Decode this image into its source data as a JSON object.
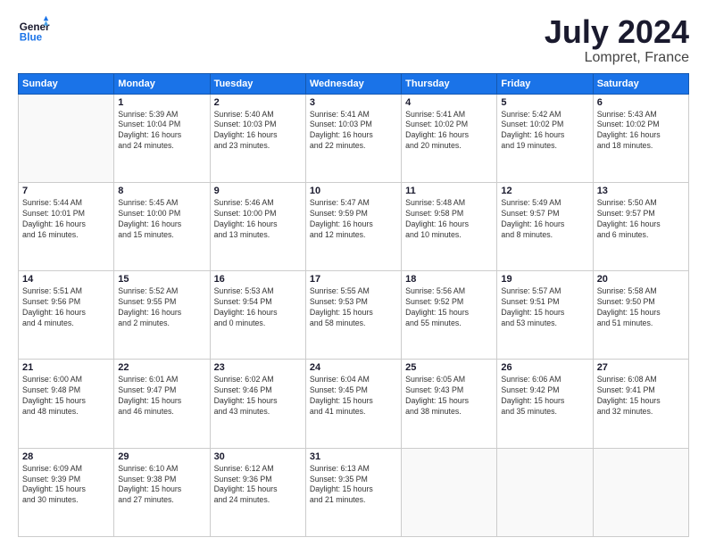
{
  "header": {
    "logo_line1": "General",
    "logo_line2": "Blue",
    "month": "July 2024",
    "location": "Lompret, France"
  },
  "weekdays": [
    "Sunday",
    "Monday",
    "Tuesday",
    "Wednesday",
    "Thursday",
    "Friday",
    "Saturday"
  ],
  "weeks": [
    [
      {
        "day": "",
        "info": ""
      },
      {
        "day": "1",
        "info": "Sunrise: 5:39 AM\nSunset: 10:04 PM\nDaylight: 16 hours\nand 24 minutes."
      },
      {
        "day": "2",
        "info": "Sunrise: 5:40 AM\nSunset: 10:03 PM\nDaylight: 16 hours\nand 23 minutes."
      },
      {
        "day": "3",
        "info": "Sunrise: 5:41 AM\nSunset: 10:03 PM\nDaylight: 16 hours\nand 22 minutes."
      },
      {
        "day": "4",
        "info": "Sunrise: 5:41 AM\nSunset: 10:02 PM\nDaylight: 16 hours\nand 20 minutes."
      },
      {
        "day": "5",
        "info": "Sunrise: 5:42 AM\nSunset: 10:02 PM\nDaylight: 16 hours\nand 19 minutes."
      },
      {
        "day": "6",
        "info": "Sunrise: 5:43 AM\nSunset: 10:02 PM\nDaylight: 16 hours\nand 18 minutes."
      }
    ],
    [
      {
        "day": "7",
        "info": "Sunrise: 5:44 AM\nSunset: 10:01 PM\nDaylight: 16 hours\nand 16 minutes."
      },
      {
        "day": "8",
        "info": "Sunrise: 5:45 AM\nSunset: 10:00 PM\nDaylight: 16 hours\nand 15 minutes."
      },
      {
        "day": "9",
        "info": "Sunrise: 5:46 AM\nSunset: 10:00 PM\nDaylight: 16 hours\nand 13 minutes."
      },
      {
        "day": "10",
        "info": "Sunrise: 5:47 AM\nSunset: 9:59 PM\nDaylight: 16 hours\nand 12 minutes."
      },
      {
        "day": "11",
        "info": "Sunrise: 5:48 AM\nSunset: 9:58 PM\nDaylight: 16 hours\nand 10 minutes."
      },
      {
        "day": "12",
        "info": "Sunrise: 5:49 AM\nSunset: 9:57 PM\nDaylight: 16 hours\nand 8 minutes."
      },
      {
        "day": "13",
        "info": "Sunrise: 5:50 AM\nSunset: 9:57 PM\nDaylight: 16 hours\nand 6 minutes."
      }
    ],
    [
      {
        "day": "14",
        "info": "Sunrise: 5:51 AM\nSunset: 9:56 PM\nDaylight: 16 hours\nand 4 minutes."
      },
      {
        "day": "15",
        "info": "Sunrise: 5:52 AM\nSunset: 9:55 PM\nDaylight: 16 hours\nand 2 minutes."
      },
      {
        "day": "16",
        "info": "Sunrise: 5:53 AM\nSunset: 9:54 PM\nDaylight: 16 hours\nand 0 minutes."
      },
      {
        "day": "17",
        "info": "Sunrise: 5:55 AM\nSunset: 9:53 PM\nDaylight: 15 hours\nand 58 minutes."
      },
      {
        "day": "18",
        "info": "Sunrise: 5:56 AM\nSunset: 9:52 PM\nDaylight: 15 hours\nand 55 minutes."
      },
      {
        "day": "19",
        "info": "Sunrise: 5:57 AM\nSunset: 9:51 PM\nDaylight: 15 hours\nand 53 minutes."
      },
      {
        "day": "20",
        "info": "Sunrise: 5:58 AM\nSunset: 9:50 PM\nDaylight: 15 hours\nand 51 minutes."
      }
    ],
    [
      {
        "day": "21",
        "info": "Sunrise: 6:00 AM\nSunset: 9:48 PM\nDaylight: 15 hours\nand 48 minutes."
      },
      {
        "day": "22",
        "info": "Sunrise: 6:01 AM\nSunset: 9:47 PM\nDaylight: 15 hours\nand 46 minutes."
      },
      {
        "day": "23",
        "info": "Sunrise: 6:02 AM\nSunset: 9:46 PM\nDaylight: 15 hours\nand 43 minutes."
      },
      {
        "day": "24",
        "info": "Sunrise: 6:04 AM\nSunset: 9:45 PM\nDaylight: 15 hours\nand 41 minutes."
      },
      {
        "day": "25",
        "info": "Sunrise: 6:05 AM\nSunset: 9:43 PM\nDaylight: 15 hours\nand 38 minutes."
      },
      {
        "day": "26",
        "info": "Sunrise: 6:06 AM\nSunset: 9:42 PM\nDaylight: 15 hours\nand 35 minutes."
      },
      {
        "day": "27",
        "info": "Sunrise: 6:08 AM\nSunset: 9:41 PM\nDaylight: 15 hours\nand 32 minutes."
      }
    ],
    [
      {
        "day": "28",
        "info": "Sunrise: 6:09 AM\nSunset: 9:39 PM\nDaylight: 15 hours\nand 30 minutes."
      },
      {
        "day": "29",
        "info": "Sunrise: 6:10 AM\nSunset: 9:38 PM\nDaylight: 15 hours\nand 27 minutes."
      },
      {
        "day": "30",
        "info": "Sunrise: 6:12 AM\nSunset: 9:36 PM\nDaylight: 15 hours\nand 24 minutes."
      },
      {
        "day": "31",
        "info": "Sunrise: 6:13 AM\nSunset: 9:35 PM\nDaylight: 15 hours\nand 21 minutes."
      },
      {
        "day": "",
        "info": ""
      },
      {
        "day": "",
        "info": ""
      },
      {
        "day": "",
        "info": ""
      }
    ]
  ]
}
